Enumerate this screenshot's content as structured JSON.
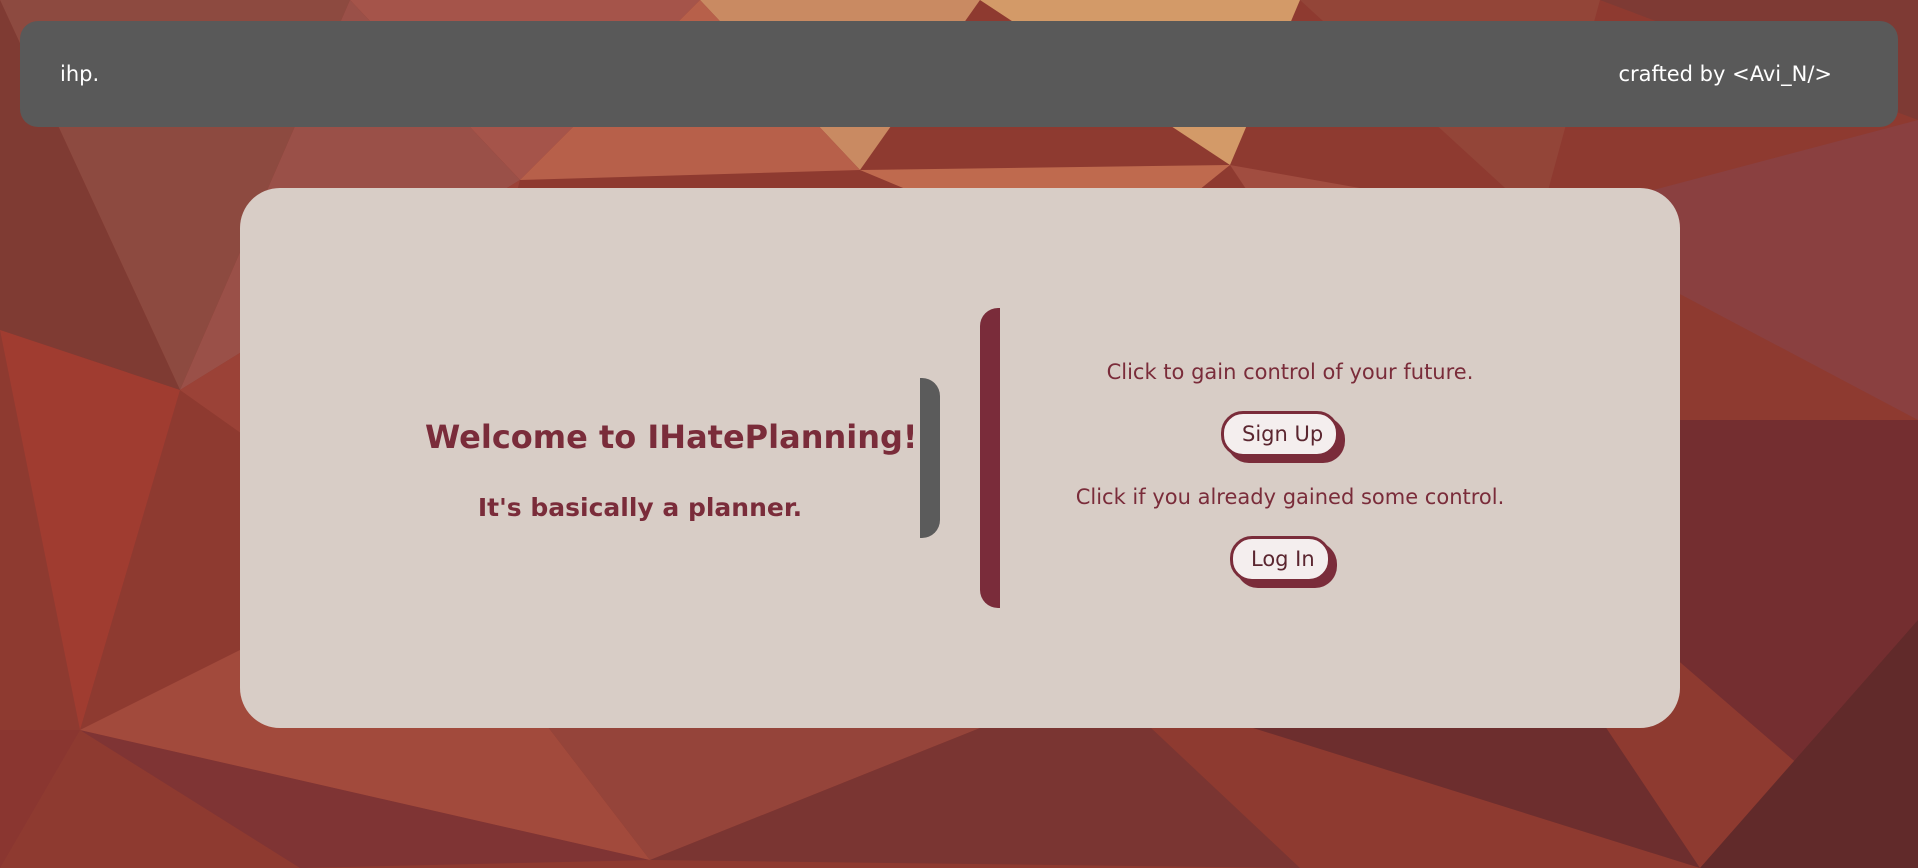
{
  "navbar": {
    "brand": "ihp.",
    "credit": "crafted by <Avi_N/>"
  },
  "hero": {
    "title": "Welcome to IHatePlanning!",
    "subtitle": "It's basically a planner."
  },
  "auth": {
    "signup_prompt": "Click to gain control of your future.",
    "signup_label": "Sign Up",
    "login_prompt": "Click if you already gained some control.",
    "login_label": "Log In"
  },
  "colors": {
    "accent": "#7a2c3a",
    "navbar_bg": "#595959",
    "card_bg": "#d8cdc6",
    "button_bg": "#f4eeee"
  }
}
